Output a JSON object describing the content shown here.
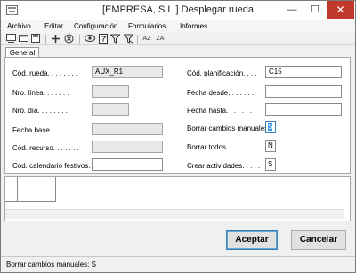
{
  "window": {
    "title": "[EMPRESA, S.L.] Desplegar rueda",
    "controls": {
      "minimize": "—",
      "maximize": "☐",
      "close": "✕"
    }
  },
  "menu": {
    "items": [
      "Archivo",
      "Editar",
      "Configuración",
      "Formularios",
      "Informes"
    ]
  },
  "toolbar": {
    "sort_az": "AZ",
    "sort_za": "ZA"
  },
  "tabs": [
    "General"
  ],
  "form": {
    "cod_rueda": {
      "label": "Cód. rueda. . . . . . . .",
      "value": "AUX_R1"
    },
    "nro_linea": {
      "label": "Nro. línea. . . . . . .",
      "value": ""
    },
    "nro_dia": {
      "label": "Nro. día. . . . . . . .",
      "value": ""
    },
    "fecha_base": {
      "label": "Fecha base. . . . . . . .",
      "value": ""
    },
    "cod_recurso": {
      "label": "Cód. recurso. . . . . . .",
      "value": ""
    },
    "cod_calendario": {
      "label": "Cód. calendario festivos.",
      "value": ""
    },
    "cod_planificacion": {
      "label": "Cód. planificación. . . .",
      "value": "C15"
    },
    "fecha_desde": {
      "label": "Fecha desde. . . . . . .",
      "value": ""
    },
    "fecha_hasta": {
      "label": "Fecha hasta. . . . . . .",
      "value": ""
    },
    "borrar_cambios": {
      "label": "Borrar cambios manuales.",
      "value": "S"
    },
    "borrar_todos": {
      "label": "Borrar todos. . . . . . .",
      "value": "N"
    },
    "crear_actividades": {
      "label": "Crear actividades. . . . .",
      "value": "S"
    }
  },
  "buttons": {
    "accept": "Aceptar",
    "cancel": "Cancelar"
  },
  "status": {
    "text": "Borrar cambios manuales: S"
  },
  "icons": [
    "new-document-icon",
    "open-window-icon",
    "save-icon",
    "add-icon",
    "delete-icon",
    "view-icon",
    "filter-doc-icon",
    "filter-icon",
    "filter-clear-icon",
    "sort-az-icon",
    "sort-za-icon"
  ]
}
